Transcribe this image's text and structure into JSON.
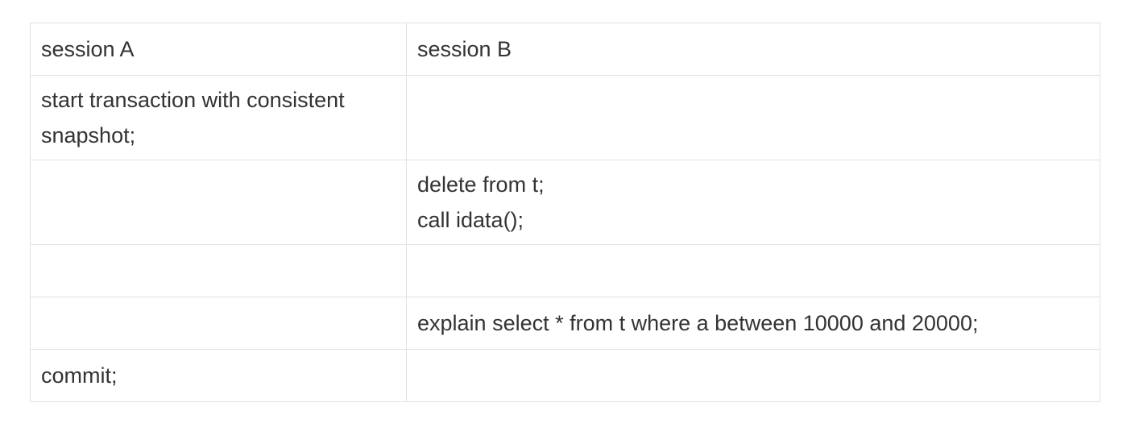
{
  "table": {
    "header": {
      "session_a": "session A",
      "session_b": "session B"
    },
    "rows": [
      {
        "session_a": "start transaction with consistent\nsnapshot;",
        "session_b": ""
      },
      {
        "session_a": "",
        "session_b": "delete from t;\ncall idata();"
      },
      {
        "session_a": "",
        "session_b": ""
      },
      {
        "session_a": "",
        "session_b": "explain select * from t where a between 10000 and 20000;"
      },
      {
        "session_a": "commit;",
        "session_b": ""
      }
    ]
  }
}
